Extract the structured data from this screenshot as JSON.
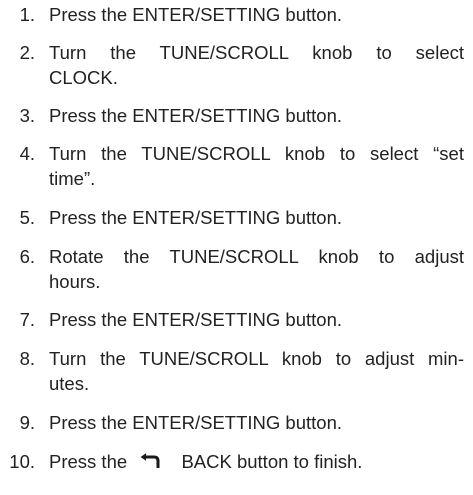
{
  "steps": [
    {
      "number": "1.",
      "text": "Press the ENTER/SETTING button."
    },
    {
      "number": "2.",
      "line1": "Turn the TUNE/SCROLL knob to select",
      "line2": "CLOCK."
    },
    {
      "number": "3.",
      "text": "Press the ENTER/SETTING button."
    },
    {
      "number": "4.",
      "line1": "Turn the TUNE/SCROLL knob to select “set",
      "line2": "time”."
    },
    {
      "number": "5.",
      "text": "Press the ENTER/SETTING button."
    },
    {
      "number": "6.",
      "line1": "Rotate the TUNE/SCROLL knob to adjust",
      "line2": "hours."
    },
    {
      "number": "7.",
      "text": "Press the ENTER/SETTING button."
    },
    {
      "number": "8.",
      "line1": "Turn the TUNE/SCROLL knob to adjust min-",
      "line2": "utes."
    },
    {
      "number": "9.",
      "text": "Press the ENTER/SETTING button."
    },
    {
      "number": "10.",
      "text_before_icon": "Press the",
      "icon": "back-arrow-icon",
      "text_after_icon": "BACK button to finish."
    }
  ]
}
